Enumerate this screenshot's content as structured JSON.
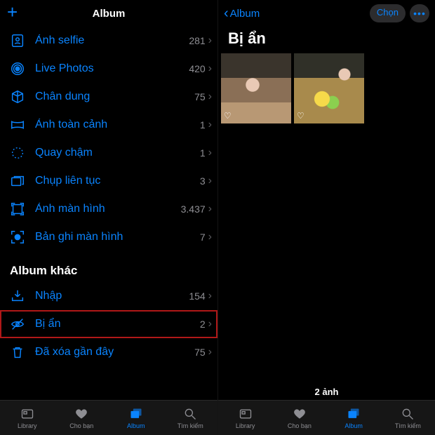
{
  "left": {
    "header": {
      "title": "Album",
      "add_label": "+"
    },
    "rows": [
      {
        "icon": "selfie",
        "label": "Ảnh selfie",
        "count": "281"
      },
      {
        "icon": "live",
        "label": "Live Photos",
        "count": "420"
      },
      {
        "icon": "portrait",
        "label": "Chân dung",
        "count": "75"
      },
      {
        "icon": "pano",
        "label": "Ảnh toàn cảnh",
        "count": "1"
      },
      {
        "icon": "slomo",
        "label": "Quay chậm",
        "count": "1"
      },
      {
        "icon": "burst",
        "label": "Chụp liên tục",
        "count": "3"
      },
      {
        "icon": "screenshot",
        "label": "Ảnh màn hình",
        "count": "3.437"
      },
      {
        "icon": "screenrec",
        "label": "Bản ghi màn hình",
        "count": "7"
      }
    ],
    "section2_title": "Album khác",
    "rows2": [
      {
        "icon": "import",
        "label": "Nhập",
        "count": "154",
        "hilite": false
      },
      {
        "icon": "hidden",
        "label": "Bị ẩn",
        "count": "2",
        "hilite": true
      },
      {
        "icon": "trash",
        "label": "Đã xóa gần đây",
        "count": "75",
        "hilite": false
      }
    ]
  },
  "right": {
    "back_label": "Album",
    "select_label": "Chọn",
    "title": "Bị ẩn",
    "count_label": "2 ảnh"
  },
  "tabs": [
    {
      "label": "Library",
      "active": false
    },
    {
      "label": "Cho bạn",
      "active": false
    },
    {
      "label": "Album",
      "active": true
    },
    {
      "label": "Tìm kiếm",
      "active": false
    }
  ]
}
